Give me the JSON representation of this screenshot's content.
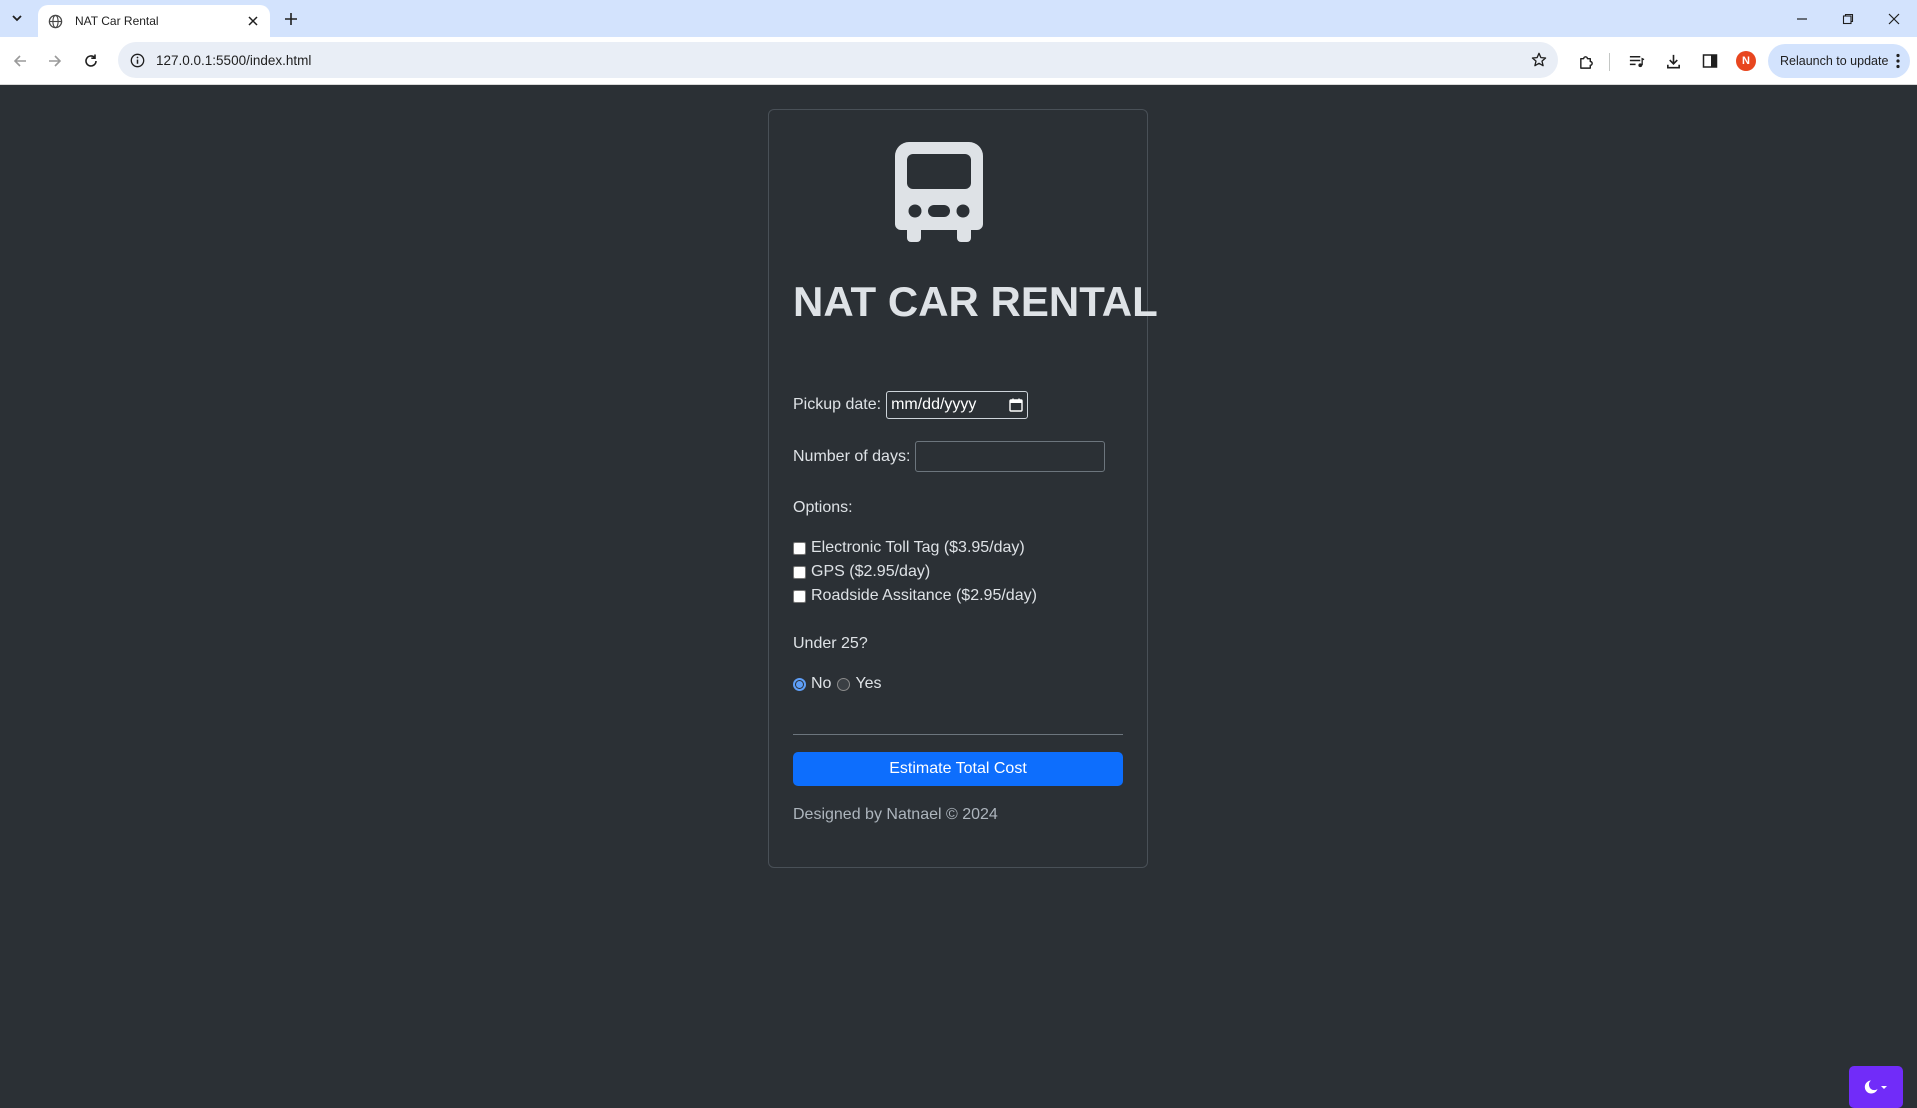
{
  "browser": {
    "tab_title": "NAT Car Rental",
    "url": "127.0.0.1:5500/index.html",
    "avatar_initial": "N",
    "relaunch_label": "Relaunch to update"
  },
  "app": {
    "logo_icon": "bus-front-icon",
    "title": "NAT CAR RENTAL",
    "pickup_label": "Pickup date:",
    "pickup_placeholder": "mm/dd/yyyy",
    "days_label": "Number of days:",
    "days_value": "",
    "options_heading": "Options:",
    "options": [
      {
        "label": "Electronic Toll Tag ($3.95/day)",
        "checked": false
      },
      {
        "label": "GPS ($2.95/day)",
        "checked": false
      },
      {
        "label": "Roadside Assitance ($2.95/day)",
        "checked": false
      }
    ],
    "under25_heading": "Under 25?",
    "under25_options": [
      {
        "label": "No",
        "selected": true
      },
      {
        "label": "Yes",
        "selected": false
      }
    ],
    "submit_label": "Estimate Total Cost",
    "footer": "Designed by Natnael © 2024"
  },
  "colors": {
    "page_bg": "#2b3035",
    "primary": "#0d6efd",
    "theme_toggle": "#712cf9"
  }
}
